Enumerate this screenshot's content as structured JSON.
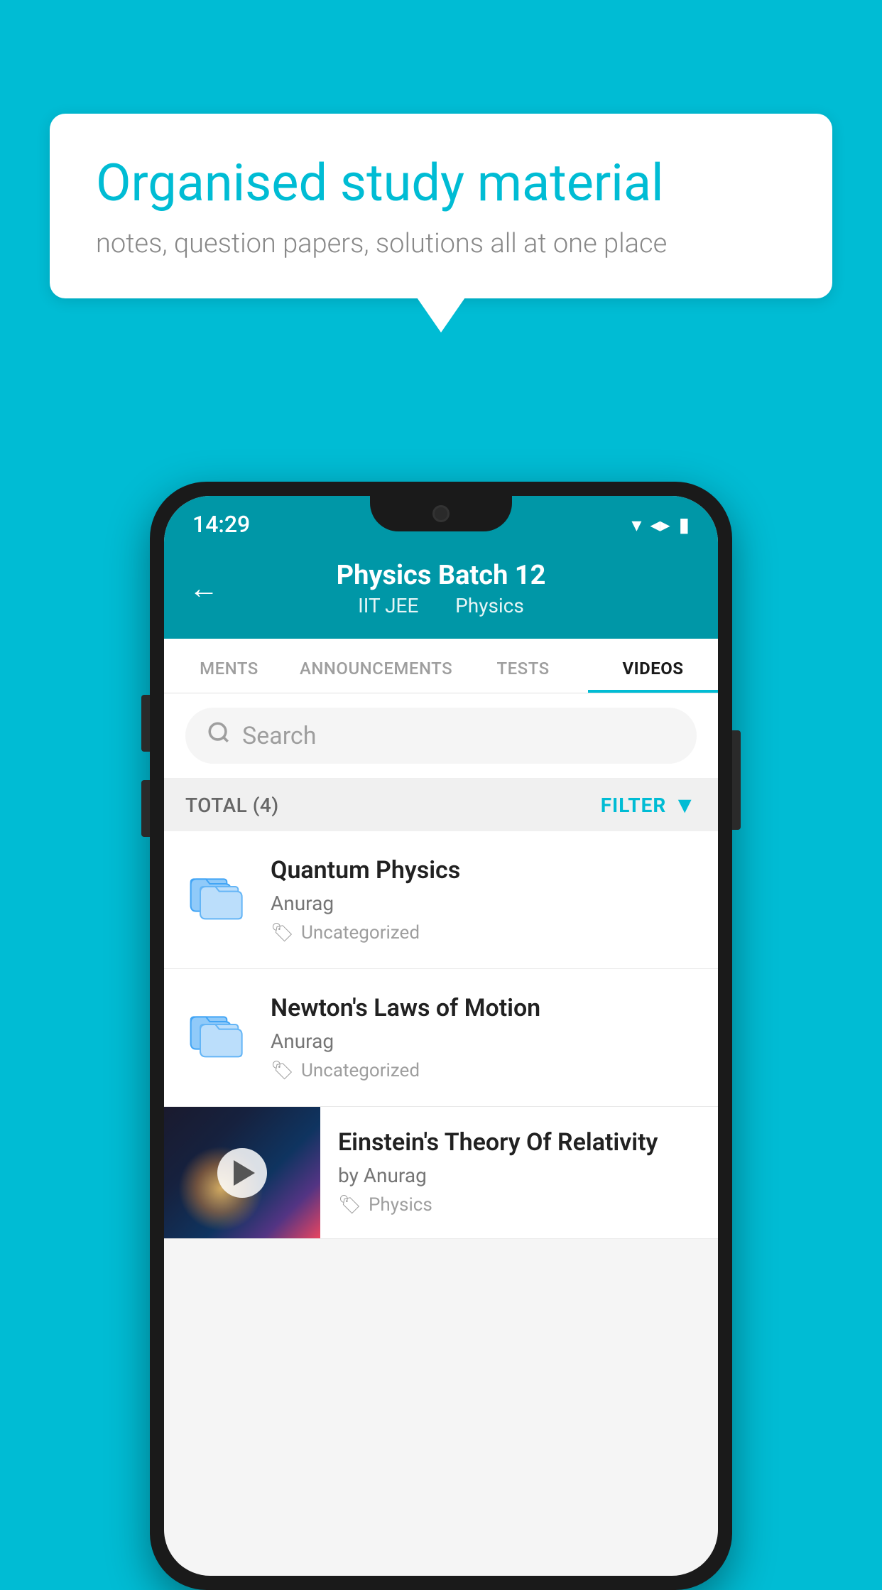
{
  "background": {
    "color": "#00bcd4"
  },
  "speech_bubble": {
    "heading": "Organised study material",
    "subtext": "notes, question papers, solutions all at one place"
  },
  "status_bar": {
    "time": "14:29"
  },
  "app_header": {
    "title": "Physics Batch 12",
    "subtitle_part1": "IIT JEE",
    "subtitle_part2": "Physics",
    "back_label": "←"
  },
  "tabs": [
    {
      "label": "MENTS",
      "active": false
    },
    {
      "label": "ANNOUNCEMENTS",
      "active": false
    },
    {
      "label": "TESTS",
      "active": false
    },
    {
      "label": "VIDEOS",
      "active": true
    }
  ],
  "search": {
    "placeholder": "Search"
  },
  "filter_bar": {
    "total_label": "TOTAL (4)",
    "filter_label": "FILTER"
  },
  "videos": [
    {
      "title": "Quantum Physics",
      "author": "Anurag",
      "tag": "Uncategorized",
      "type": "folder"
    },
    {
      "title": "Newton's Laws of Motion",
      "author": "Anurag",
      "tag": "Uncategorized",
      "type": "folder"
    },
    {
      "title": "Einstein's Theory Of Relativity",
      "author": "by Anurag",
      "tag": "Physics",
      "type": "thumb"
    }
  ]
}
